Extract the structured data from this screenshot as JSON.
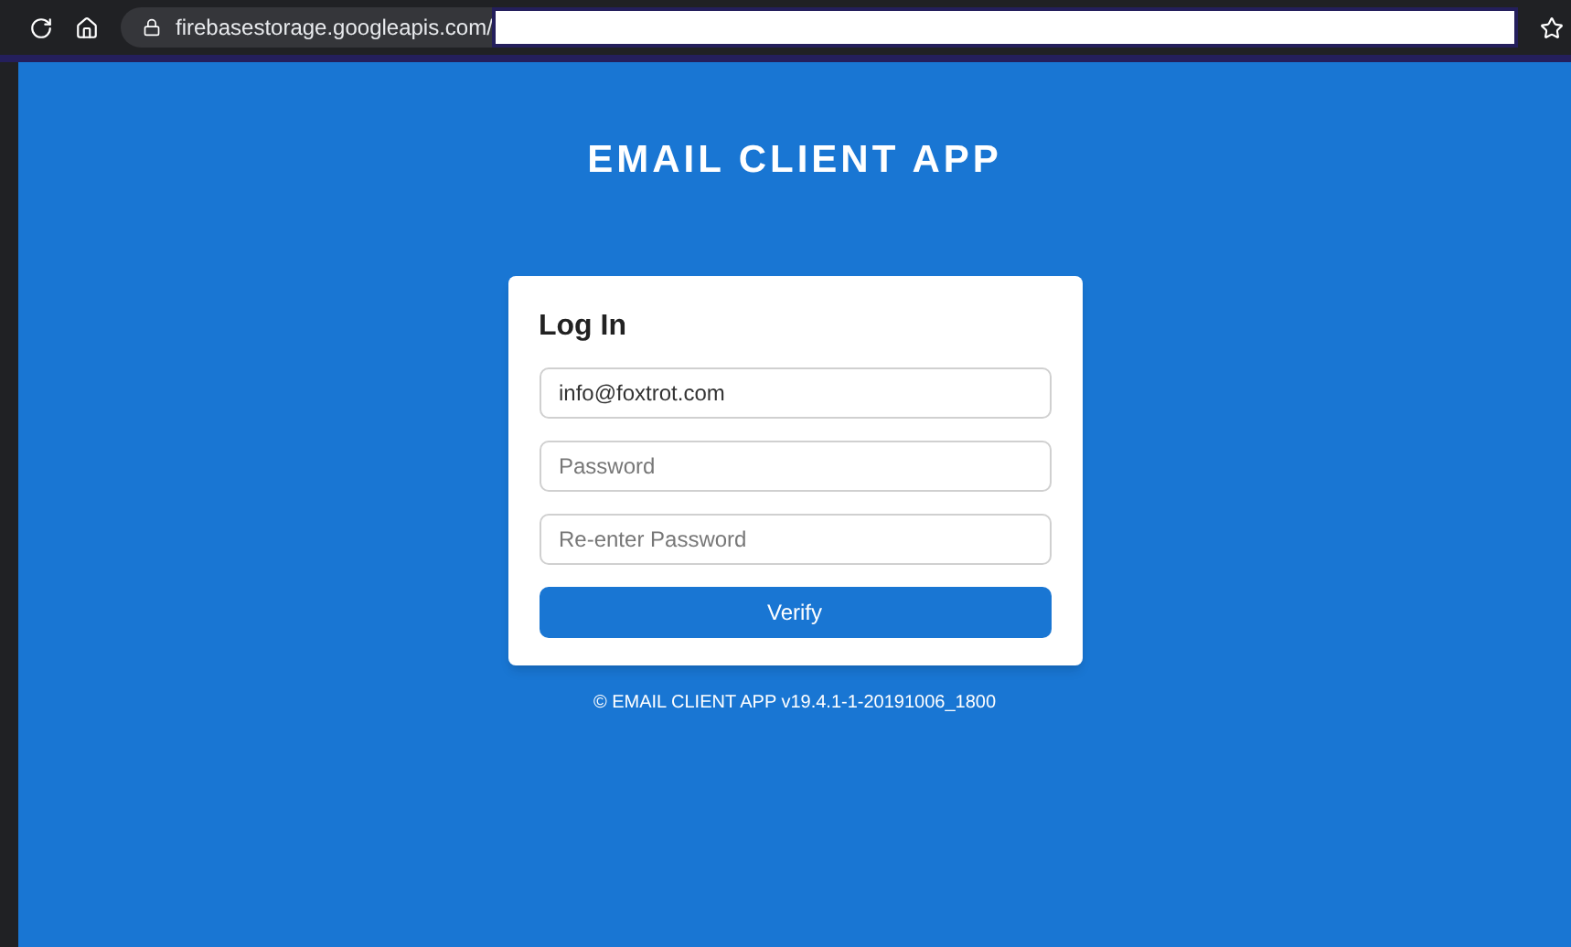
{
  "browser": {
    "url": "firebasestorage.googleapis.com/"
  },
  "app_title": "EMAIL CLIENT APP",
  "login": {
    "heading": "Log In",
    "fields": [
      {
        "value": "info@foxtrot.com"
      },
      {
        "placeholder": "Password"
      },
      {
        "placeholder": "Re-enter Password"
      }
    ],
    "button": "Verify"
  },
  "footer": "© EMAIL CLIENT APP v19.4.1-1-20191006_1800"
}
